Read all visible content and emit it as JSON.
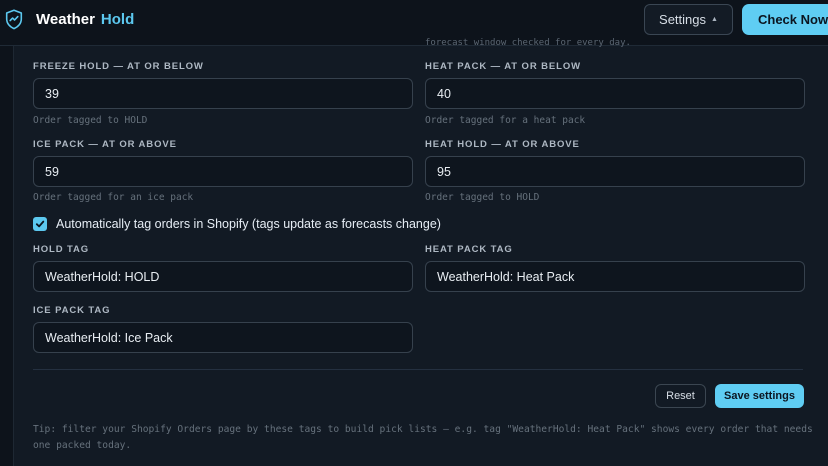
{
  "app": {
    "name_a": "Weather",
    "name_b": "Hold",
    "logo_icon": "shield-check-icon"
  },
  "header": {
    "settings_label": "Settings",
    "settings_caret": "▲",
    "check_label": "Check Now"
  },
  "cutoff_text": "forecast window checked for every day.",
  "fields": {
    "freeze_hold": {
      "label": "FREEZE HOLD — AT OR BELOW",
      "value": "39",
      "hint": "Order tagged to HOLD"
    },
    "heat_pack": {
      "label": "HEAT PACK — AT OR BELOW",
      "value": "40",
      "hint": "Order tagged for a heat pack"
    },
    "ice_pack": {
      "label": "ICE PACK — AT OR ABOVE",
      "value": "59",
      "hint": "Order tagged for an ice pack"
    },
    "heat_hold": {
      "label": "HEAT HOLD — AT OR ABOVE",
      "value": "95",
      "hint": "Order tagged to HOLD"
    }
  },
  "auto_tag": {
    "checked": true,
    "label": "Automatically tag orders in Shopify (tags update as forecasts change)"
  },
  "tags": {
    "hold_tag": {
      "label": "HOLD TAG",
      "value": "WeatherHold: HOLD"
    },
    "heat_pack_tag": {
      "label": "HEAT PACK TAG",
      "value": "WeatherHold: Heat Pack"
    },
    "ice_pack_tag": {
      "label": "ICE PACK TAG",
      "value": "WeatherHold: Ice Pack"
    }
  },
  "actions": {
    "reset_label": "Reset",
    "save_label": "Save settings"
  },
  "tip": "Tip: filter your Shopify Orders page by these tags to build pick lists — e.g. tag \"WeatherHold: Heat Pack\" shows every order that needs one packed today.",
  "colors": {
    "accent": "#5fcdf3",
    "background": "#0d131b",
    "panel": "#121a24"
  }
}
